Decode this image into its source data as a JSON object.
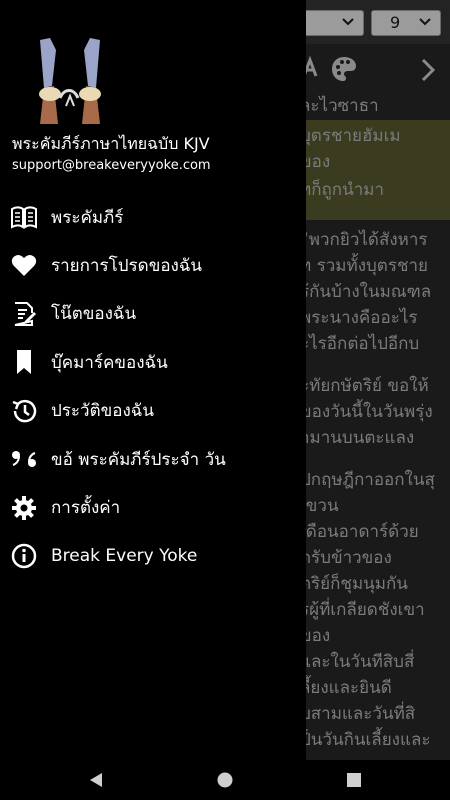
{
  "background_app": {
    "book_select_value": "",
    "chapter_select_value": "9",
    "text_lines": [
      "ละไวซาธา",
      "บุตรชายฮัมเม",
      "ของ",
      "ทก็ถูกนำมา",
      "",
      "“พวกยิวได้สังหาร",
      "ท รวมทั้งบุตรชาย",
      "ร้กันบ้างในมณฑล",
      "พระนางคืออะไร",
      "ะไรอีกต่อไปอีกบ",
      "",
      "ะทัยกษัตริย์ ขอให้",
      "ของวันนี้ในวันพรุ่ง",
      "ามานบนตะแลง",
      "",
      "ปกฤษฎีกาออกในสุ",
      "เขวน",
      "เดือนอาดาร์ด้วย",
      "ดรับข้าวของ",
      "ตริย์ก็ชุมนุมกัน",
      "รผู้ที่เกลียดชังเขา",
      "ของ",
      "และในวันทีสิบสี่",
      "ลี้ยงและยินดี",
      "บสามและวันที่สิ",
      "ป็นวันกินเลี้ยงและ"
    ],
    "accent_highlight": "#3b3b1f"
  },
  "drawer": {
    "app_title": "พระคัมภีร์ภาษาไทยฉบับ KJV",
    "email": "support@breakeveryyoke.com",
    "menu": [
      {
        "icon": "book-icon",
        "label": "พระคัมภีร์"
      },
      {
        "icon": "heart-icon",
        "label": "รายการโปรดของฉัน"
      },
      {
        "icon": "note-icon",
        "label": "โน๊ตของฉัน"
      },
      {
        "icon": "bookmark-icon",
        "label": "บุ๊คมาร์คของฉัน"
      },
      {
        "icon": "history-icon",
        "label": "ประวัติของฉัน"
      },
      {
        "icon": "quote-icon",
        "label": "ขอ้ พระคัมภีร์ประจำ วัน"
      },
      {
        "icon": "gear-icon",
        "label": "การตั้งค่า"
      },
      {
        "icon": "info-icon",
        "label": "Break Every Yoke"
      }
    ]
  },
  "navigation_bar": {
    "buttons": [
      "back-icon",
      "home-icon",
      "recents-icon"
    ]
  }
}
